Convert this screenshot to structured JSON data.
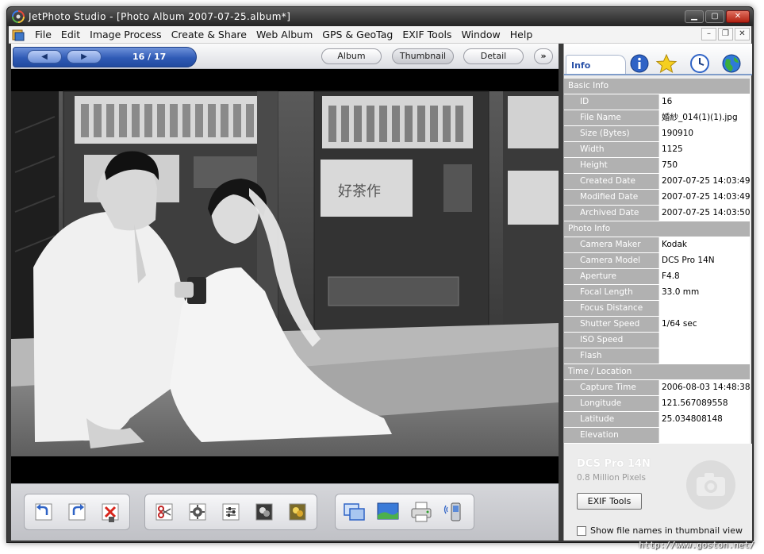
{
  "window": {
    "title": "JetPhoto Studio - [Photo Album 2007-07-25.album*]"
  },
  "menu": [
    "File",
    "Edit",
    "Image Process",
    "Create & Share",
    "Web Album",
    "GPS & GeoTag",
    "EXIF Tools",
    "Window",
    "Help"
  ],
  "nav": {
    "counter": "16 / 17",
    "tabs": {
      "album": "Album",
      "thumbnail": "Thumbnail",
      "detail": "Detail",
      "more": "»"
    }
  },
  "side": {
    "active_tab": "Info",
    "sections": [
      {
        "title": "Basic Info",
        "rows": [
          {
            "label": "ID",
            "value": "16"
          },
          {
            "label": "File Name",
            "value": "婚紗_014(1)(1).jpg"
          },
          {
            "label": "Size (Bytes)",
            "value": "190910"
          },
          {
            "label": "Width",
            "value": "1125"
          },
          {
            "label": "Height",
            "value": "750"
          },
          {
            "label": "Created Date",
            "value": "2007-07-25 14:03:49"
          },
          {
            "label": "Modified Date",
            "value": "2007-07-25 14:03:49"
          },
          {
            "label": "Archived Date",
            "value": "2007-07-25 14:03:50"
          }
        ]
      },
      {
        "title": "Photo Info",
        "rows": [
          {
            "label": "Camera Maker",
            "value": "Kodak"
          },
          {
            "label": "Camera Model",
            "value": "DCS Pro 14N"
          },
          {
            "label": "Aperture",
            "value": "F4.8"
          },
          {
            "label": "Focal Length",
            "value": "33.0 mm"
          },
          {
            "label": "Focus Distance",
            "value": ""
          },
          {
            "label": "Shutter Speed",
            "value": "1/64 sec"
          },
          {
            "label": "ISO Speed",
            "value": ""
          },
          {
            "label": "Flash",
            "value": ""
          }
        ]
      },
      {
        "title": "Time / Location",
        "rows": [
          {
            "label": "Capture Time",
            "value": "2006-08-03 14:48:38"
          },
          {
            "label": "Longitude",
            "value": "121.567089558"
          },
          {
            "label": "Latitude",
            "value": "25.034808148"
          },
          {
            "label": "Elevation",
            "value": ""
          }
        ]
      }
    ],
    "camera_model": "DCS Pro 14N",
    "camera_pixels": "0.8 Million Pixels",
    "exif_button": "EXIF Tools",
    "show_filenames_label": "Show file names in thumbnail view"
  },
  "watermark": "http://www.goston.net/",
  "icons": {
    "toolbar": [
      "rotate-left-icon",
      "rotate-right-icon",
      "delete-icon",
      "crop-icon",
      "auto-enhance-icon",
      "adjust-icon",
      "effects-icon",
      "frame-icon",
      "slideshow-icon",
      "wallpaper-icon",
      "print-icon",
      "mobile-icon"
    ],
    "side_tabs": [
      "info-icon",
      "star-icon",
      "clock-icon",
      "globe-icon"
    ]
  }
}
